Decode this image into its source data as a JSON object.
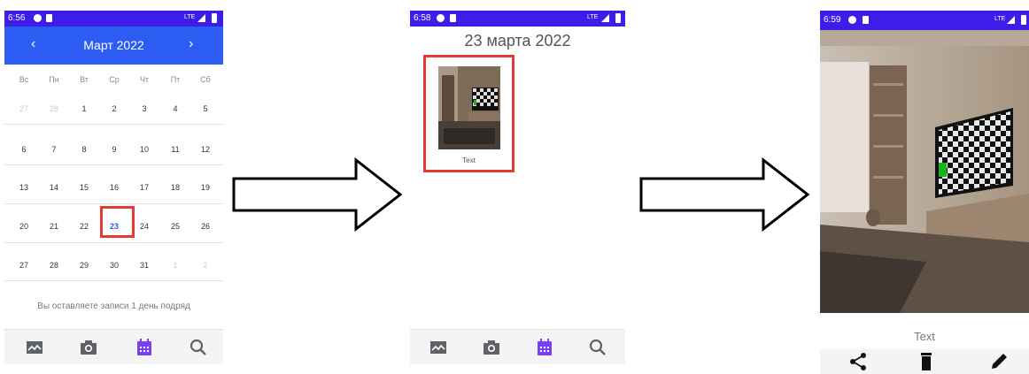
{
  "colors": {
    "status_bar": "#3d1de8",
    "calendar_header": "#2d5cf3",
    "highlight": "#e53935",
    "nav_active": "#7b3ff2",
    "nav_icon": "#5f6368"
  },
  "screen1": {
    "status": {
      "time": "6:56",
      "network": "LTE"
    },
    "header": {
      "prev": "‹",
      "month": "Март  2022",
      "next": "›"
    },
    "weekdays": [
      "Вс",
      "Пн",
      "Вт",
      "Ср",
      "Чт",
      "Пт",
      "Сб"
    ],
    "weeks": [
      [
        "27",
        "28",
        "1",
        "2",
        "3",
        "4",
        "5"
      ],
      [
        "6",
        "7",
        "8",
        "9",
        "10",
        "11",
        "12"
      ],
      [
        "13",
        "14",
        "15",
        "16",
        "17",
        "18",
        "19"
      ],
      [
        "20",
        "21",
        "22",
        "23",
        "24",
        "25",
        "26"
      ],
      [
        "27",
        "28",
        "29",
        "30",
        "31",
        "1",
        "2"
      ]
    ],
    "selected_day": "23",
    "streak_text": "Вы оставляете записи 1 день подряд",
    "nav": [
      "gallery-icon",
      "camera-icon",
      "calendar-icon",
      "search-icon"
    ],
    "nav_active": "calendar-icon"
  },
  "screen2": {
    "status": {
      "time": "6:58",
      "network": "LTE"
    },
    "date_title": "23 марта 2022",
    "entry": {
      "caption": "Text",
      "image": "room-with-checkerboard-tv"
    },
    "nav": [
      "gallery-icon",
      "camera-icon",
      "calendar-icon",
      "search-icon"
    ],
    "nav_active": "calendar-icon"
  },
  "screen3": {
    "status": {
      "time": "6:59",
      "network": "LTE"
    },
    "image": "room-with-checkerboard-tv",
    "caption": "Text",
    "actions": [
      "share-icon",
      "delete-icon",
      "edit-icon"
    ]
  }
}
